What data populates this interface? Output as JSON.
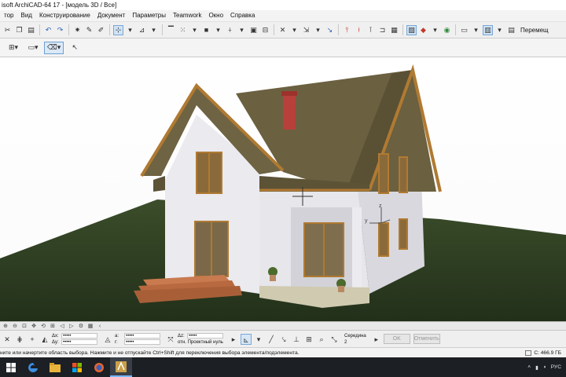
{
  "window": {
    "title": "isoft ArchiCAD-64 17 - [модель 3D / Все]"
  },
  "menu": [
    "тор",
    "Вид",
    "Конструирование",
    "Документ",
    "Параметры",
    "Teamwork",
    "Окно",
    "Справка"
  ],
  "toolbar": {
    "navigator_label": "Перемещ"
  },
  "status": {
    "message": "ните или начертите область выбора. Нажмите и не отпускайте Ctrl+Shift для переключения выбора элемента/подэлемента.",
    "disk_free": "С: 466.9 ГБ"
  },
  "coords": {
    "dx_label": "Δx:",
    "dx_value": "•••••",
    "dy_label": "Δy:",
    "dy_value": "•••••",
    "a_label": "a:",
    "a_value": "•••••",
    "r_label": "r:",
    "r_value": "•••••",
    "dz_label": "Δz:",
    "dz_value": "•••••",
    "ref_label": "отн. Проектный нуль",
    "snap_label": "Середина",
    "snap_value": "2",
    "ok_label": "OK",
    "cancel_label": "Отменить"
  },
  "viewport": {
    "colors": {
      "ground": "#2b3a1f",
      "wall": "#e9e9ee",
      "roof": "#6b6040",
      "trim": "#b07a32",
      "chimney": "#b8403a",
      "stairs": "#c0714a"
    },
    "axis_labels": {
      "z": "z",
      "y": "y"
    }
  },
  "taskbar": {
    "items": [
      "windows-start-icon",
      "edge-icon",
      "file-explorer-icon",
      "windows-store-icon",
      "firefox-icon",
      "archicad-icon"
    ],
    "lang": "РУС"
  }
}
